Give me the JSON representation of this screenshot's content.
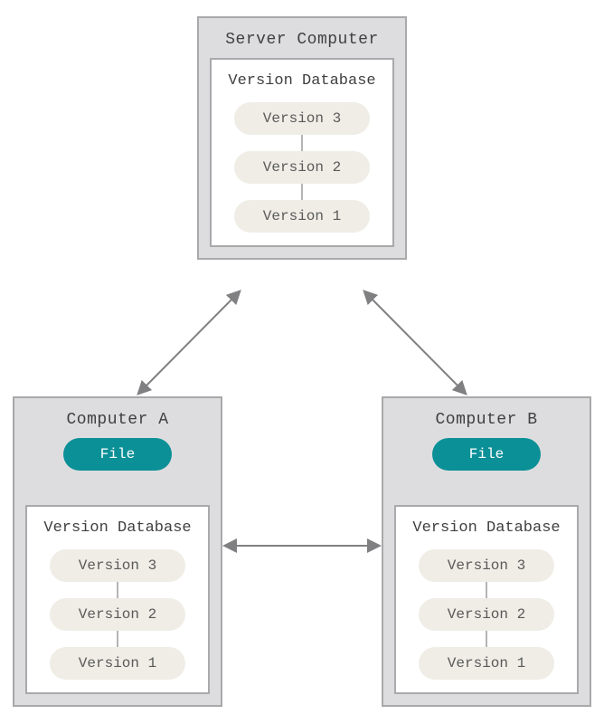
{
  "server": {
    "title": "Server Computer",
    "vdb": {
      "title": "Version Database",
      "versions": [
        "Version 3",
        "Version 2",
        "Version 1"
      ]
    }
  },
  "computerA": {
    "title": "Computer A",
    "file_label": "File",
    "vdb": {
      "title": "Version Database",
      "versions": [
        "Version 3",
        "Version 2",
        "Version 1"
      ]
    }
  },
  "computerB": {
    "title": "Computer B",
    "vdb": {
      "title": "Version Database",
      "versions": [
        "Version 3",
        "Version 2",
        "Version 1"
      ]
    },
    "file_label": "File"
  },
  "colors": {
    "box_bg": "#dddddf",
    "box_border": "#a9a9ab",
    "file_pill": "#0b9097",
    "version_pill": "#efede6",
    "arrow": "#808082"
  }
}
